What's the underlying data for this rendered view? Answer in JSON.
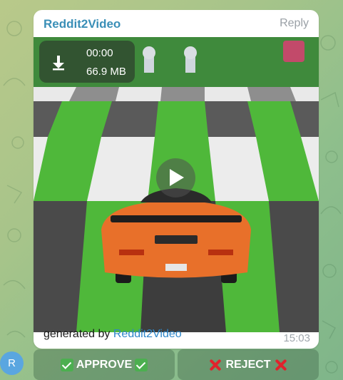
{
  "message": {
    "sender": "Reddit2Video",
    "reply_label": "Reply",
    "media": {
      "duration": "00:00",
      "file_size": "66.9 MB",
      "download_icon": "download-arrow-icon",
      "play_icon": "play-icon"
    },
    "caption_prefix": "generated by",
    "caption_link": "Reddit2Video",
    "time": "15:03"
  },
  "keyboard": {
    "approve_label": "APPROVE",
    "reject_label": "REJECT"
  },
  "avatar": {
    "initial": "R",
    "color": "#5aa6e0"
  },
  "colors": {
    "sender": "#3a8fb7",
    "link": "#2d86c9",
    "approve_emoji": "#4caf50",
    "reject_emoji": "#e0232c"
  }
}
